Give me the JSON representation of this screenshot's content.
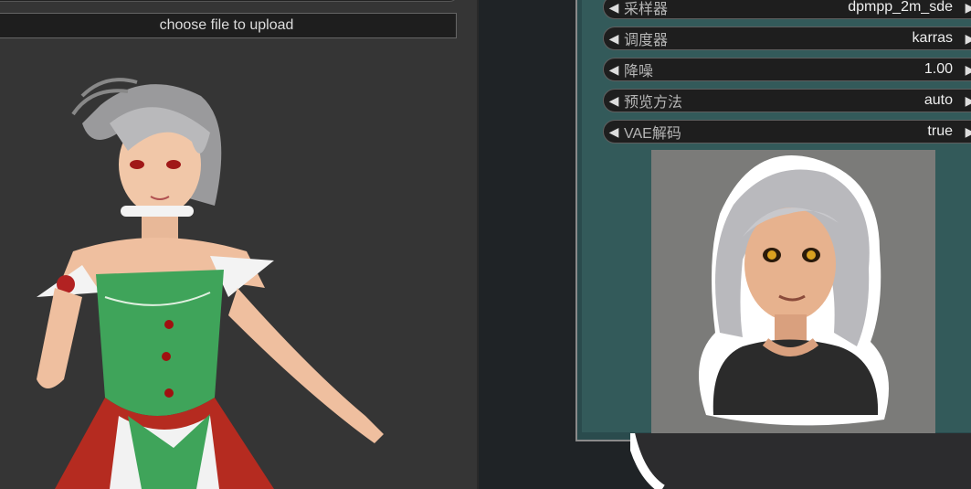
{
  "left_node": {
    "upload_label": "choose file to upload"
  },
  "right_node": {
    "params": [
      {
        "label": "采样器",
        "value": "dpmpp_2m_sde"
      },
      {
        "label": "调度器",
        "value": "karras"
      },
      {
        "label": "降噪",
        "value": "1.00"
      },
      {
        "label": "预览方法",
        "value": "auto"
      },
      {
        "label": "VAE解码",
        "value": "true"
      }
    ]
  },
  "icons": {
    "decrement": "◀",
    "increment": "▶"
  },
  "colors": {
    "canvas_bg": "#1f2326",
    "left_node_bg": "#353535",
    "right_node_bg": "#335a5a",
    "widget_bg": "#1e1e1e"
  }
}
